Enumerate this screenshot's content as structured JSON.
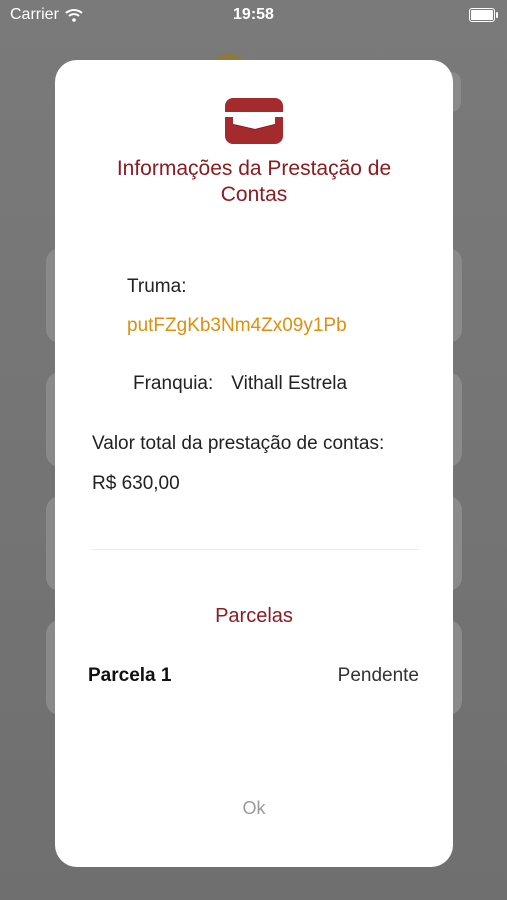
{
  "status_bar": {
    "carrier": "Carrier",
    "time": "19:58"
  },
  "dialog": {
    "title": "Informações da Prestação de Contas",
    "turma_label": "Truma:",
    "turma_value": "putFZgKb3Nm4Zx09y1Pb",
    "franquia_label": "Franquia:",
    "franquia_value": "Vithall Estrela",
    "valor_label": "Valor total da prestação de contas:",
    "valor_value": "R$ 630,00",
    "parcelas_title": "Parcelas",
    "parcelas": [
      {
        "name": "Parcela 1",
        "status": "Pendente"
      }
    ],
    "ok_label": "Ok"
  },
  "colors": {
    "accent": "#8c1c22",
    "highlight": "#e08e0b",
    "muted": "#9a9a9a"
  },
  "icons": [
    "wifi-icon",
    "battery-icon",
    "wallet-icon"
  ]
}
